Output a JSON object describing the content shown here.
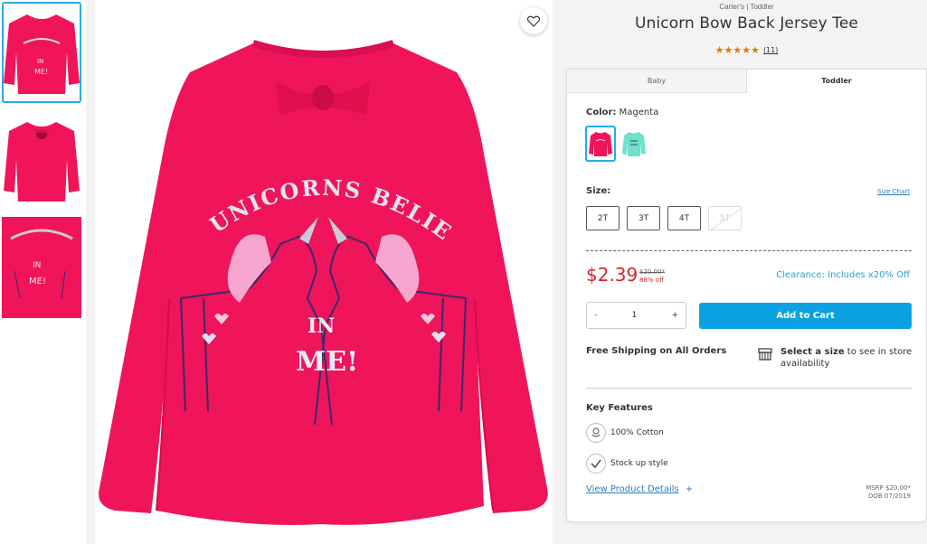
{
  "product": {
    "brand_line": "Carter's | Toddler",
    "title": "Unicorn Bow Back Jersey Tee",
    "stars": "★★★★★",
    "review_count": "(11)"
  },
  "tabs": [
    {
      "label": "Baby",
      "active": false
    },
    {
      "label": "Toddler",
      "active": true
    }
  ],
  "color": {
    "label": "Color:",
    "value": "Magenta",
    "swatches": [
      "magenta",
      "aqua"
    ]
  },
  "size": {
    "label": "Size:",
    "chart_link": "Size Chart",
    "options": [
      {
        "label": "2T",
        "available": true
      },
      {
        "label": "3T",
        "available": true
      },
      {
        "label": "4T",
        "available": true
      },
      {
        "label": "5T",
        "available": false
      }
    ]
  },
  "pricing": {
    "price": "$2.39",
    "was": "$20.00*",
    "off": "88% off",
    "clearance": "Clearance: Includes x20% Off"
  },
  "cart": {
    "minus": "-",
    "quantity": "1",
    "plus": "+",
    "add_label": "Add to Cart"
  },
  "shipping": {
    "free": "Free Shipping on All Orders",
    "store_bold": "Select a size",
    "store_rest": " to see in store availability"
  },
  "features": {
    "heading": "Key Features",
    "items": [
      {
        "label": "100% Cotton",
        "icon": "cotton-icon"
      },
      {
        "label": "Stock up style",
        "icon": "check-icon"
      }
    ]
  },
  "details": {
    "link": "View Product Details",
    "plus": "+",
    "msrp": "MSRP $20.00*",
    "dob": "DOB 07/2019"
  },
  "shirt": {
    "line1": "UNICORNS BELIEVE",
    "line2": "IN",
    "line3": "ME!"
  },
  "colors": {
    "shirt": "#f0145a",
    "accent": "#0aa2e0",
    "price": "#d9242b"
  }
}
